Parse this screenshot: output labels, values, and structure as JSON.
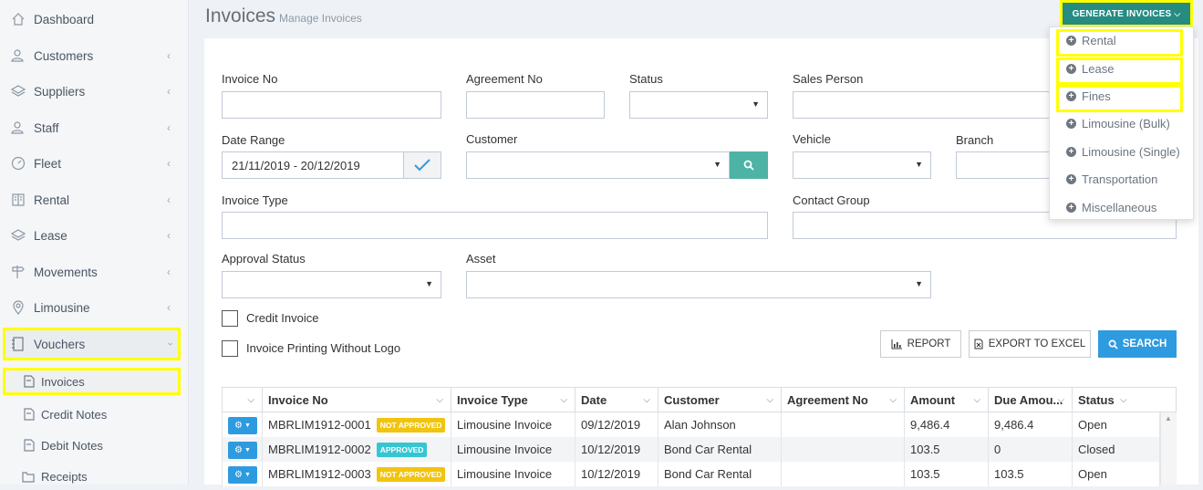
{
  "sidebar": {
    "items": [
      {
        "label": "Dashboard",
        "icon": "home-icon"
      },
      {
        "label": "Customers",
        "icon": "users-icon"
      },
      {
        "label": "Suppliers",
        "icon": "layers-icon"
      },
      {
        "label": "Staff",
        "icon": "user-icon"
      },
      {
        "label": "Fleet",
        "icon": "speedometer-icon"
      },
      {
        "label": "Rental",
        "icon": "book-icon"
      },
      {
        "label": "Lease",
        "icon": "layers-icon"
      },
      {
        "label": "Movements",
        "icon": "signpost-icon"
      },
      {
        "label": "Limousine",
        "icon": "location-pin-icon"
      },
      {
        "label": "Vouchers",
        "icon": "notebook-icon"
      }
    ],
    "sub_items": [
      {
        "label": "Invoices",
        "icon": "document-icon"
      },
      {
        "label": "Credit Notes",
        "icon": "document-icon"
      },
      {
        "label": "Debit Notes",
        "icon": "document-icon"
      },
      {
        "label": "Receipts",
        "icon": "folder-icon"
      }
    ]
  },
  "header": {
    "title": "Invoices",
    "subtitle": "Manage Invoices",
    "generate_button": "GENERATE INVOICES"
  },
  "generate_menu": [
    "Rental",
    "Lease",
    "Fines",
    "Limousine (Bulk)",
    "Limousine (Single)",
    "Transportation",
    "Miscellaneous"
  ],
  "filters": {
    "invoice_no": {
      "label": "Invoice No",
      "value": ""
    },
    "agreement_no": {
      "label": "Agreement No",
      "value": ""
    },
    "status": {
      "label": "Status",
      "value": ""
    },
    "sales_person": {
      "label": "Sales Person",
      "value": ""
    },
    "date_range": {
      "label": "Date Range",
      "value": "21/11/2019 - 20/12/2019"
    },
    "customer": {
      "label": "Customer",
      "value": ""
    },
    "vehicle": {
      "label": "Vehicle",
      "value": ""
    },
    "branch": {
      "label": "Branch",
      "value": ""
    },
    "invoice_type": {
      "label": "Invoice Type",
      "value": ""
    },
    "contact_group": {
      "label": "Contact Group",
      "value": ""
    },
    "approval_status": {
      "label": "Approval Status",
      "value": ""
    },
    "asset": {
      "label": "Asset",
      "value": ""
    },
    "credit_invoice": {
      "label": "Credit Invoice",
      "checked": false
    },
    "print_no_logo": {
      "label": "Invoice Printing Without Logo",
      "checked": false
    }
  },
  "actions": {
    "report": "REPORT",
    "export": "EXPORT TO EXCEL",
    "search": "SEARCH"
  },
  "table": {
    "columns": [
      "Invoice No",
      "Invoice Type",
      "Date",
      "Customer",
      "Agreement No",
      "Amount",
      "Due Amou...",
      "Status"
    ],
    "rows": [
      {
        "invoice_no": "MBRLIM1912-0001",
        "badge": "NOT APPROVED",
        "badge_color": "#f1c40f",
        "type": "Limousine Invoice",
        "date": "09/12/2019",
        "customer": "Alan Johnson",
        "agreement": "",
        "amount": "9,486.4",
        "due": "9,486.4",
        "status": "Open"
      },
      {
        "invoice_no": "MBRLIM1912-0002",
        "badge": "APPROVED",
        "badge_color": "#36c6d3",
        "type": "Limousine Invoice",
        "date": "10/12/2019",
        "customer": "Bond Car Rental",
        "agreement": "",
        "amount": "103.5",
        "due": "0",
        "status": "Closed"
      },
      {
        "invoice_no": "MBRLIM1912-0003",
        "badge": "NOT APPROVED",
        "badge_color": "#f1c40f",
        "type": "Limousine Invoice",
        "date": "10/12/2019",
        "customer": "Bond Car Rental",
        "agreement": "",
        "amount": "103.5",
        "due": "103.5",
        "status": "Open"
      }
    ]
  },
  "colors": {
    "accent_teal": "#268c82",
    "search_blue": "#2e9be0",
    "highlight": "#ffff00"
  }
}
